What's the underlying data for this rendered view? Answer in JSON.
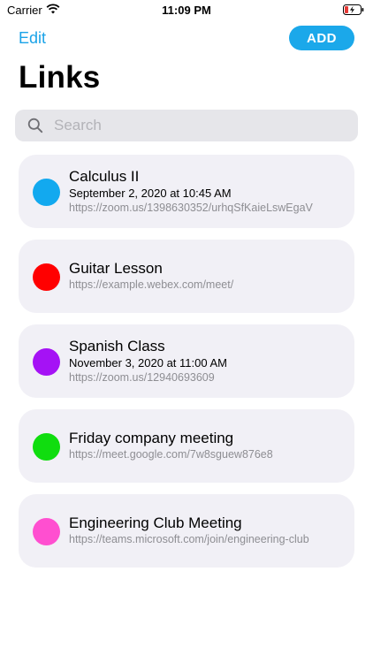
{
  "status_bar": {
    "carrier": "Carrier",
    "time": "11:09 PM"
  },
  "nav": {
    "edit_label": "Edit",
    "add_label": "ADD"
  },
  "title": "Links",
  "search": {
    "placeholder": "Search",
    "value": ""
  },
  "colors": {
    "accent": "#1ba8ea"
  },
  "links": [
    {
      "title": "Calculus II",
      "date": "September 2, 2020 at 10:45 AM",
      "url": "https://zoom.us/1398630352/urhqSfKaieLswEgaV",
      "color": "#12a9ef"
    },
    {
      "title": "Guitar Lesson",
      "date": "",
      "url": "https://example.webex.com/meet/",
      "color": "#ff0000"
    },
    {
      "title": "Spanish Class",
      "date": "November 3, 2020 at 11:00 AM",
      "url": "https://zoom.us/12940693609",
      "color": "#a512f5"
    },
    {
      "title": "Friday company meeting",
      "date": "",
      "url": "https://meet.google.com/7w8sguew876e8",
      "color": "#10dd0f"
    },
    {
      "title": "Engineering Club Meeting",
      "date": "",
      "url": "https://teams.microsoft.com/join/engineering-club",
      "color": "#ff4fd0"
    }
  ]
}
